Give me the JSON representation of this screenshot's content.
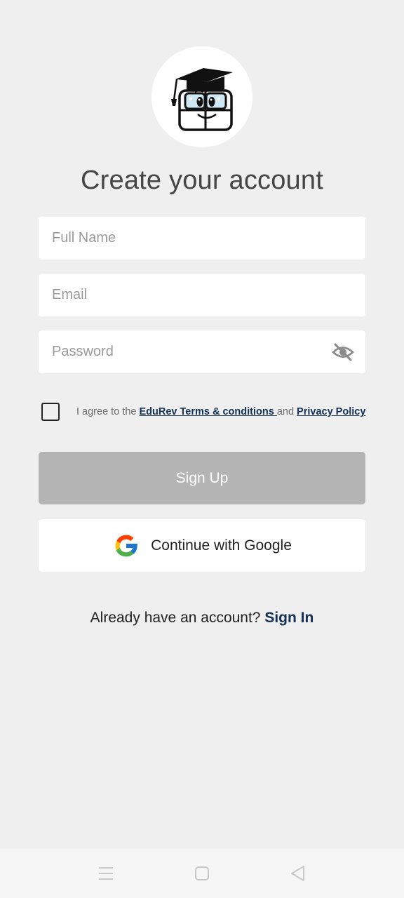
{
  "signup": {
    "title": "Create your account",
    "full_name_placeholder": "Full Name",
    "email_placeholder": "Email",
    "password_placeholder": "Password",
    "agree_prefix": "I agree to the ",
    "terms_link": "EduRev Terms & conditions ",
    "agree_and": "and ",
    "privacy_link": "Privacy Policy",
    "signup_label": "Sign Up",
    "google_label": "Continue with Google",
    "already_text": "Already have an account? ",
    "signin_label": "Sign In"
  },
  "colors": {
    "background": "#efefef",
    "accent_link": "#123154",
    "signup_disabled": "#b4b4b4"
  },
  "icons": {
    "logo": "edurev-owl-logo",
    "password_toggle": "eye-off-icon",
    "google": "google-g-icon",
    "nav_menu": "menu-icon",
    "nav_home": "home-square-icon",
    "nav_back": "back-triangle-icon"
  }
}
